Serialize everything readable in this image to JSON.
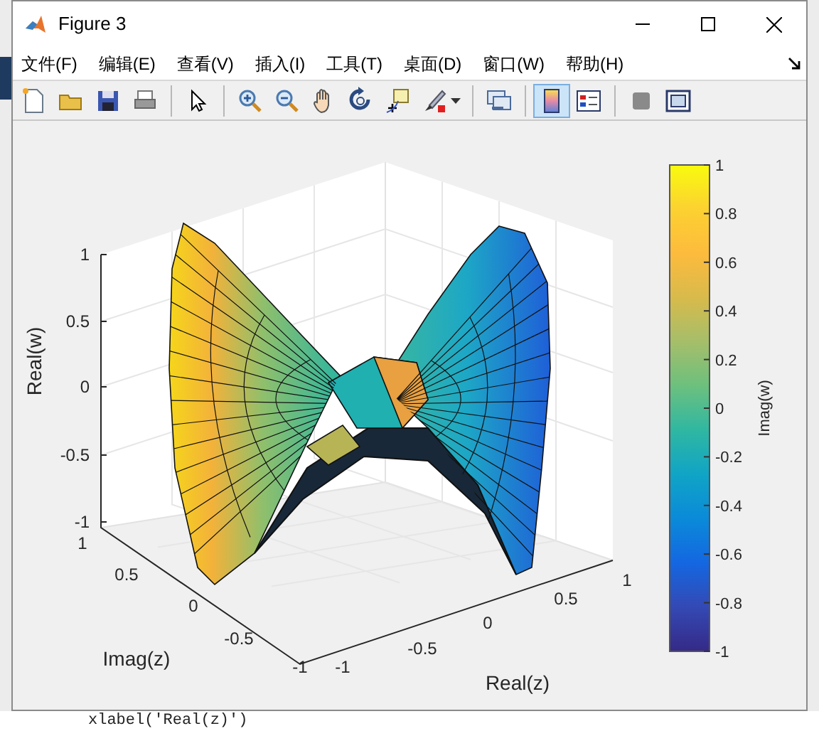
{
  "window": {
    "title": "Figure 3"
  },
  "menu": [
    {
      "label": "文件(F)"
    },
    {
      "label": "编辑(E)"
    },
    {
      "label": "查看(V)"
    },
    {
      "label": "插入(I)"
    },
    {
      "label": "工具(T)"
    },
    {
      "label": "桌面(D)"
    },
    {
      "label": "窗口(W)"
    },
    {
      "label": "帮助(H)"
    }
  ],
  "toolbar": [
    {
      "kind": "new",
      "selected": false
    },
    {
      "kind": "open",
      "selected": false
    },
    {
      "kind": "save",
      "selected": false
    },
    {
      "kind": "print",
      "selected": false
    },
    {
      "kind": "separator"
    },
    {
      "kind": "pointer",
      "selected": false
    },
    {
      "kind": "separator"
    },
    {
      "kind": "zoom-in",
      "selected": false
    },
    {
      "kind": "zoom-out",
      "selected": false
    },
    {
      "kind": "pan",
      "selected": false
    },
    {
      "kind": "rotate",
      "selected": false
    },
    {
      "kind": "data-cursor",
      "selected": false
    },
    {
      "kind": "brush",
      "selected": false
    },
    {
      "kind": "separator"
    },
    {
      "kind": "link",
      "selected": false
    },
    {
      "kind": "separator"
    },
    {
      "kind": "colorbar",
      "selected": true
    },
    {
      "kind": "legend",
      "selected": false
    },
    {
      "kind": "separator"
    },
    {
      "kind": "hide-tools",
      "selected": false
    },
    {
      "kind": "dock",
      "selected": false
    }
  ],
  "axes": {
    "z_label": "Real(w)",
    "z_ticks": [
      "1",
      "0.5",
      "0",
      "-0.5",
      "-1"
    ],
    "y_label": "Imag(z)",
    "y_ticks": [
      "1",
      "0.5",
      "0",
      "-0.5",
      "-1"
    ],
    "x_label": "Real(z)",
    "x_ticks": [
      "-1",
      "-0.5",
      "0",
      "0.5",
      "1"
    ]
  },
  "colorbar": {
    "label": "Imag(w)",
    "ticks": [
      "1",
      "0.8",
      "0.6",
      "0.4",
      "0.2",
      "0",
      "-0.2",
      "-0.4",
      "-0.6",
      "-0.8",
      "-1"
    ]
  },
  "background": {
    "code_line": "xlabel('Real(z)')"
  }
}
